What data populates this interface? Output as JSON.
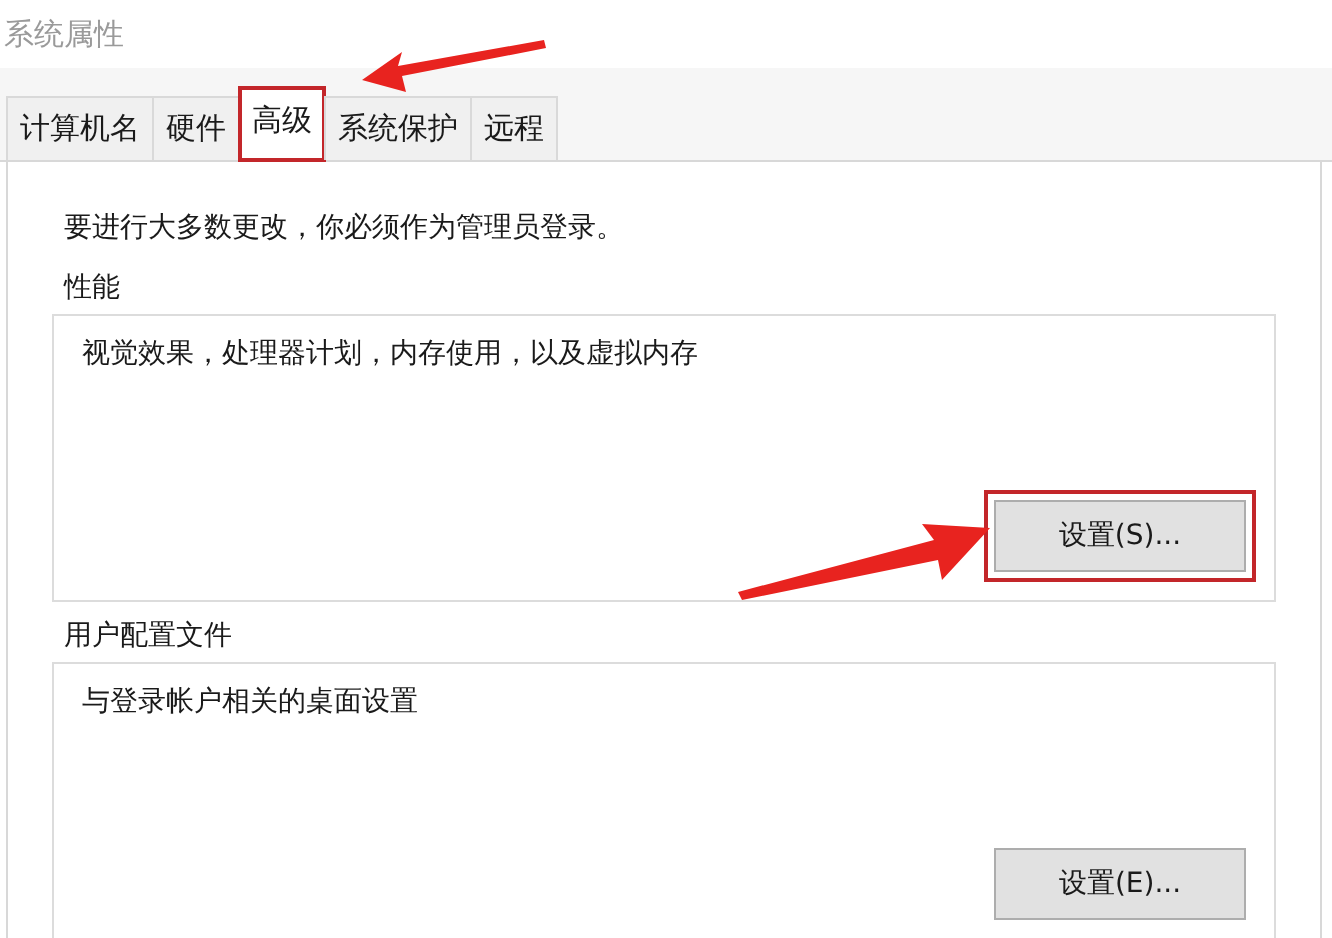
{
  "window": {
    "title": "系统属性"
  },
  "tabs": [
    {
      "label": "计算机名",
      "selected": false,
      "highlighted": false
    },
    {
      "label": "硬件",
      "selected": false,
      "highlighted": false
    },
    {
      "label": "高级",
      "selected": true,
      "highlighted": true,
      "arrow": {
        "kind": "right"
      }
    },
    {
      "label": "系统保护",
      "selected": false,
      "highlighted": false
    },
    {
      "label": "远程",
      "selected": false,
      "highlighted": false
    }
  ],
  "notice": "要进行大多数更改，你必须作为管理员登录。",
  "groups": [
    {
      "title": "性能",
      "description": "视觉效果，处理器计划，内存使用，以及虚拟内存",
      "button": {
        "label": "设置(S)...",
        "highlighted": true,
        "arrow": {
          "kind": "left"
        }
      }
    },
    {
      "title": "用户配置文件",
      "description": "与登录帐户相关的桌面设置",
      "button": {
        "label": "设置(E)...",
        "highlighted": false
      }
    }
  ]
}
